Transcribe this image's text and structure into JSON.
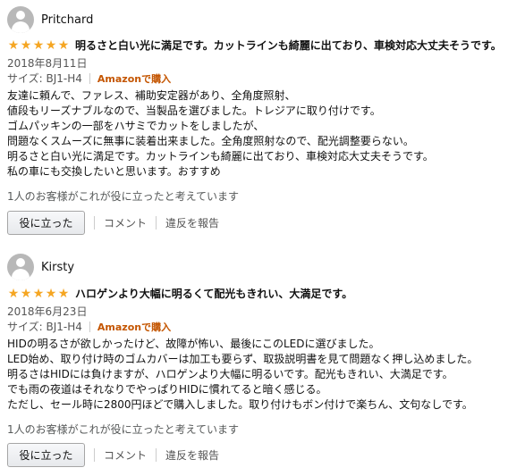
{
  "reviews": [
    {
      "reviewer": "Pritchard",
      "stars": 5,
      "title": "明るさと白い光に満足です。カットラインも綺麗に出ており、車検対応大丈夫そうです。",
      "date": "2018年8月11日",
      "size": "サイズ: BJ1-H4",
      "purchase_badge": "Amazonで購入",
      "body_lines": [
        "友達に頼んで、ファレス、補助安定器があり、全角度照射、",
        "値段もリーズナブルなので、当製品を選びました。トレジアに取り付けです。",
        "ゴムパッキンの一部をハサミでカットをしましたが、",
        "問題なくスムーズに無事に装着出来ました。全角度照射なので、配光調整要らない。",
        "明るさと白い光に満足です。カットラインも綺麗に出ており、車検対応大丈夫そうです。",
        "私の車にも交換したいと思います。おすすめ"
      ],
      "helpful_text": "1人のお客様がこれが役に立ったと考えています",
      "helpful_button": "役に立った",
      "comment_link": "コメント",
      "report_link": "違反を報告"
    },
    {
      "reviewer": "Kirsty",
      "stars": 5,
      "title": "ハロゲンより大幅に明るくて配光もきれい、大満足です。",
      "date": "2018年6月23日",
      "size": "サイズ: BJ1-H4",
      "purchase_badge": "Amazonで購入",
      "body_lines": [
        "HIDの明るさが欲しかったけど、故障が怖い、最後にこのLEDに選びました。",
        "LED始め、取り付け時のゴムカバーは加工も要らず、取扱説明書を見て問題なく押し込めました。",
        "明るさはHIDには負けますが、ハロゲンより大幅に明るいです。配光もきれい、大満足です。",
        "でも雨の夜道はそれなりでやっぱりHIDに慣れてると暗く感じる。",
        "ただし、セール時に2800円ほどで購入しました。取り付けもボン付けで楽ちん、文句なしです。"
      ],
      "helpful_text": "1人のお客様がこれが役に立ったと考えています",
      "helpful_button": "役に立った",
      "comment_link": "コメント",
      "report_link": "違反を報告"
    }
  ],
  "colors": {
    "star": "#f5a623",
    "purchase_badge": "#c45500",
    "meta": "#555555"
  },
  "icons": {
    "avatar": "default-user-avatar-icon",
    "star": "filled-star-icon"
  }
}
